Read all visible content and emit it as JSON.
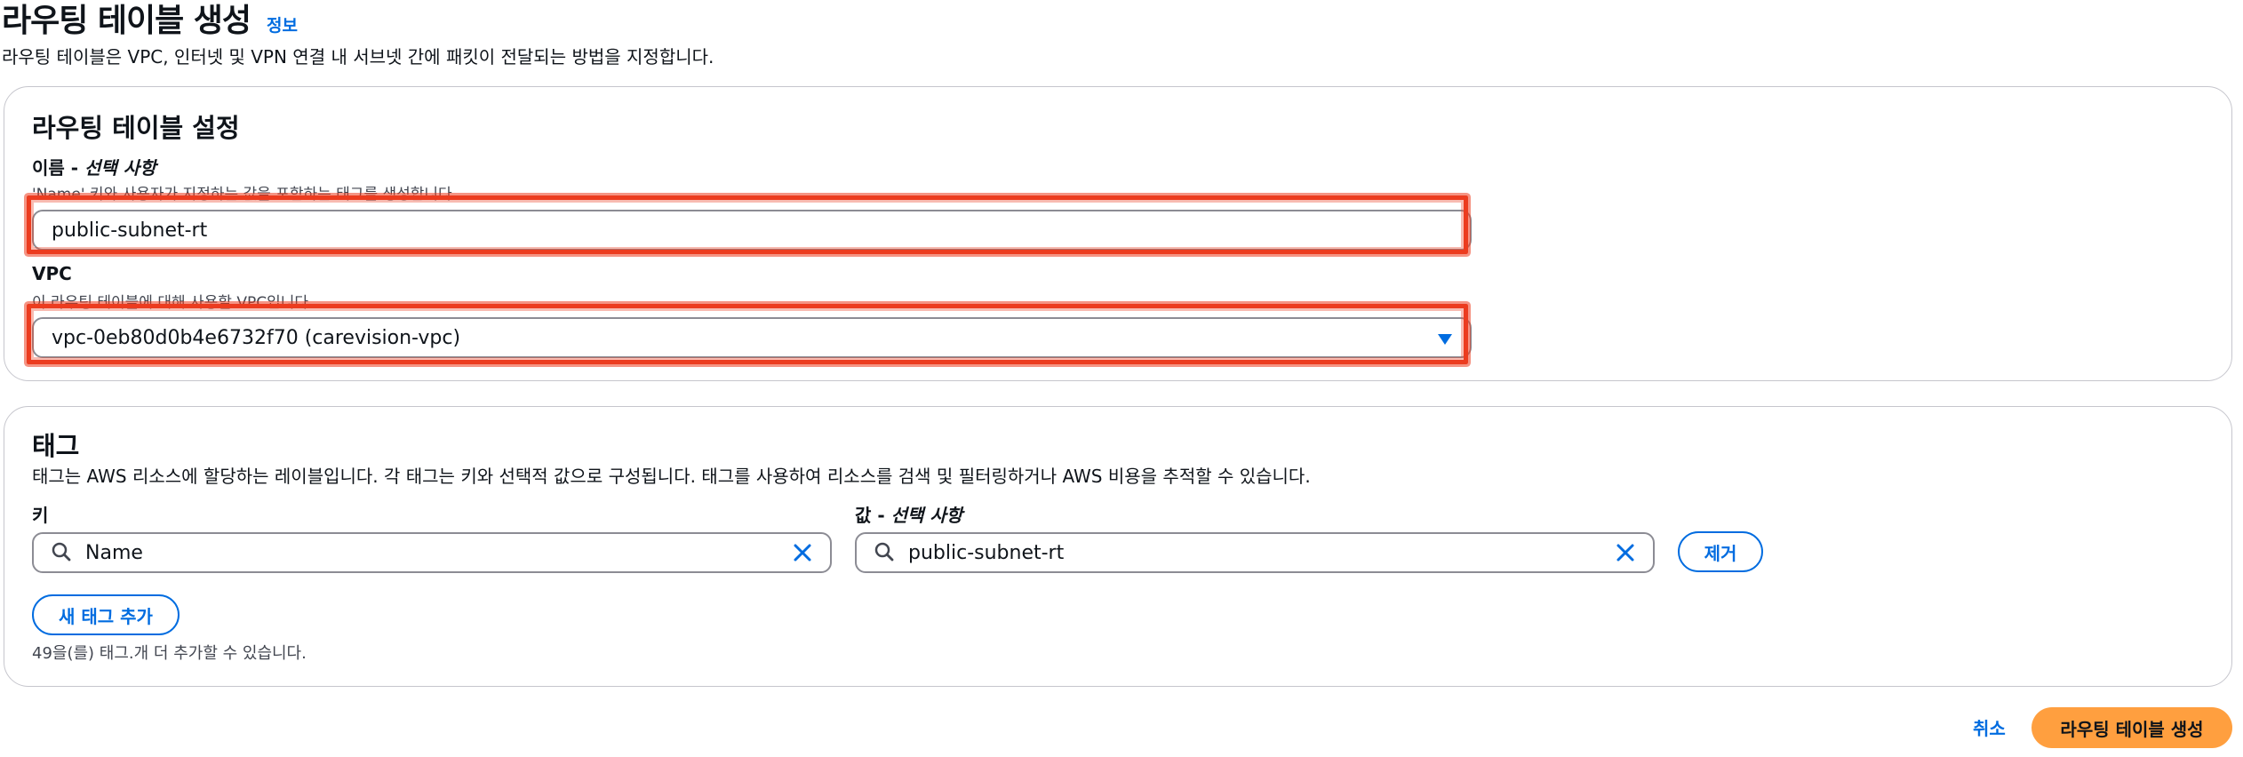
{
  "page": {
    "title": "라우팅 테이블 생성",
    "info_link": "정보",
    "description": "라우팅 테이블은 VPC, 인터넷 및 VPN 연결 내 서브넷 간에 패킷이 전달되는 방법을 지정합니다."
  },
  "settings": {
    "title": "라우팅 테이블 설정",
    "name_label": "이름 - ",
    "name_label_optional": "선택 사항",
    "name_description": "'Name' 키와 사용자가 지정하는 값을 포함하는 태그를 생성합니다.",
    "name_value": "public-subnet-rt",
    "vpc_label": "VPC",
    "vpc_description": "이 라우팅 테이블에 대해 사용할 VPC입니다.",
    "vpc_value": "vpc-0eb80d0b4e6732f70 (carevision-vpc)"
  },
  "tags": {
    "title": "태그",
    "description": "태그는 AWS 리소스에 할당하는 레이블입니다. 각 태그는 키와 선택적 값으로 구성됩니다. 태그를 사용하여 리소스를 검색 및 필터링하거나 AWS 비용을 추적할 수 있습니다.",
    "key_label": "키",
    "value_label": "값 - ",
    "value_label_optional": "선택 사항",
    "key_value": "Name",
    "value_value": "public-subnet-rt",
    "remove_button": "제거",
    "add_button": "새 태그 추가",
    "remaining": "49을(를) 태그.개 더 추가할 수 있습니다."
  },
  "footer": {
    "cancel": "취소",
    "create": "라우팅 테이블 생성"
  },
  "colors": {
    "accent": "#006ce0",
    "primary_button": "#ff9f3f",
    "highlight": "#ec3c1f"
  },
  "icons": {
    "search": "search-icon",
    "clear": "clear-icon",
    "dropdown": "caret-down-icon"
  }
}
